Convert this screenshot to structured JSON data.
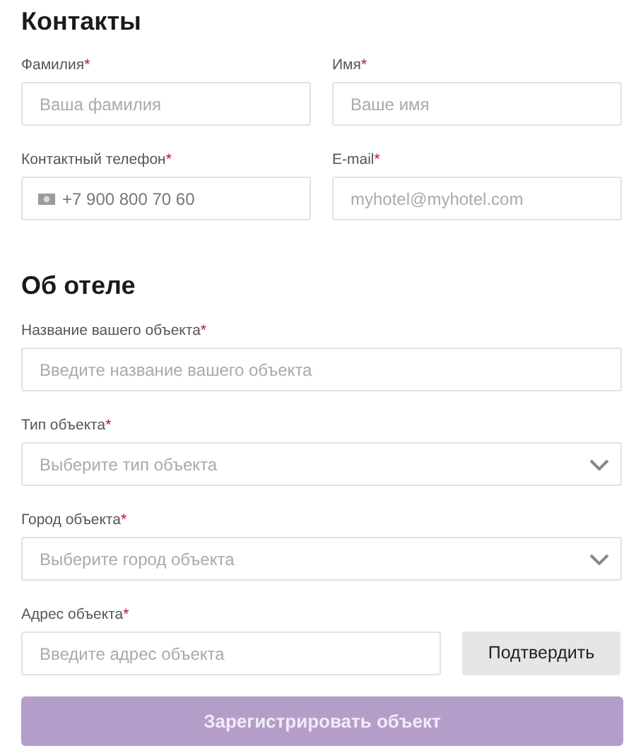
{
  "sections": [
    {
      "title": "Контакты",
      "rows": [
        [
          {
            "kind": "text",
            "label": "Фамилия",
            "mark": "*",
            "placeholder": "Ваша фамилия"
          },
          {
            "kind": "text",
            "label": "Имя",
            "mark": "*",
            "placeholder": "Ваше имя"
          }
        ],
        [
          {
            "kind": "phone",
            "label": "Контактный телефон",
            "mark": "*",
            "placeholder": "+7 900 800 70 60"
          },
          {
            "kind": "text",
            "label": "E-mail",
            "mark": "*",
            "placeholder": "myhotel@myhotel.com"
          }
        ]
      ]
    },
    {
      "title": "Об отеле",
      "rows": [
        [
          {
            "kind": "text",
            "label": "Название вашего объекта",
            "mark": "*",
            "placeholder": "Введите название вашего объекта"
          }
        ],
        [
          {
            "kind": "select",
            "label": "Тип объекта",
            "mark": "*",
            "placeholder": "Выберите тип объекта"
          }
        ],
        [
          {
            "kind": "select",
            "label": "Город объекта",
            "mark": "*",
            "placeholder": "Выберите город объекта"
          }
        ],
        [
          {
            "kind": "address",
            "label": "Адрес объекта",
            "mark": "*",
            "placeholder": "Введите адрес объекта",
            "button": "Подтвердить"
          }
        ]
      ]
    }
  ],
  "submit": {
    "label": "Зарегистрировать объект",
    "disabled": true
  }
}
